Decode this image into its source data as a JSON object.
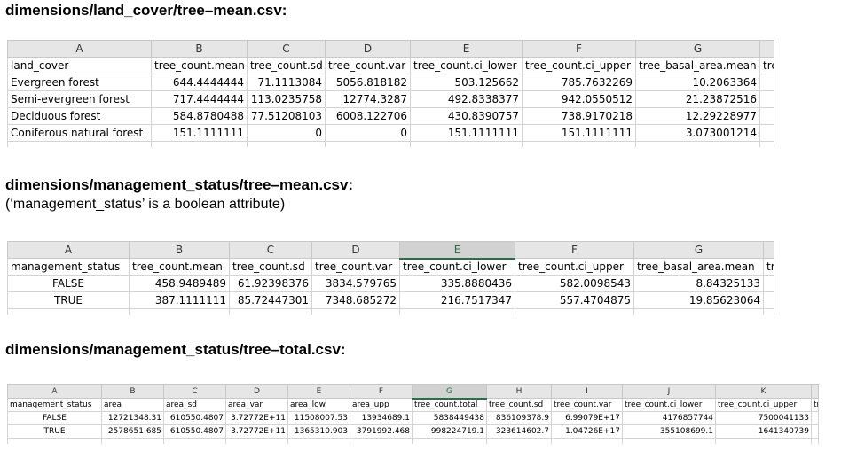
{
  "sections": [
    {
      "title": "dimensions/land_cover/tree–mean.csv:",
      "table": {
        "columns": [
          "A",
          "B",
          "C",
          "D",
          "E",
          "F",
          "G",
          ""
        ],
        "rows": [
          [
            "land_cover",
            "tree_count.mean",
            "tree_count.sd",
            "tree_count.var",
            "tree_count.ci_lower",
            "tree_count.ci_upper",
            "tree_basal_area.mean",
            "tre"
          ],
          [
            "Evergreen forest",
            "644.4444444",
            "71.1113084",
            "5056.818182",
            "503.125662",
            "785.7632269",
            "10.2063364",
            ""
          ],
          [
            "Semi-evergreen forest",
            "717.4444444",
            "113.0235758",
            "12774.3287",
            "492.8338377",
            "942.0550512",
            "21.23872516",
            ""
          ],
          [
            "Deciduous forest",
            "584.8780488",
            "77.51208103",
            "6008.122706",
            "430.8390757",
            "738.9170218",
            "12.29228977",
            ""
          ],
          [
            "Coniferous natural forest",
            "151.1111111",
            "0",
            "0",
            "151.1111111",
            "151.1111111",
            "3.073001214",
            ""
          ]
        ]
      }
    },
    {
      "title": "dimensions/management_status/tree–mean.csv:",
      "note": "(‘management_status’ is a boolean attribute)",
      "table": {
        "columns": [
          "A",
          "B",
          "C",
          "D",
          "E",
          "F",
          "G",
          ""
        ],
        "rows": [
          [
            "management_status",
            "tree_count.mean",
            "tree_count.sd",
            "tree_count.var",
            "tree_count.ci_lower",
            "tree_count.ci_upper",
            "tree_basal_area.mean",
            "tre"
          ],
          [
            "FALSE",
            "458.9489489",
            "61.92398376",
            "3834.579765",
            "335.8880436",
            "582.0098543",
            "8.84325133",
            ""
          ],
          [
            "TRUE",
            "387.1111111",
            "85.72447301",
            "7348.685272",
            "216.7517347",
            "557.4704875",
            "19.85623064",
            ""
          ]
        ]
      }
    },
    {
      "title": "dimensions/management_status/tree–total.csv:",
      "table": {
        "columns": [
          "A",
          "B",
          "C",
          "D",
          "E",
          "F",
          "G",
          "H",
          "I",
          "J",
          "K",
          ""
        ],
        "rows": [
          [
            "management_status",
            "area",
            "area_sd",
            "area_var",
            "area_low",
            "area_upp",
            "tree_count.total",
            "tree_count.sd",
            "tree_count.var",
            "tree_count.ci_lower",
            "tree_count.ci_upper",
            "tr"
          ],
          [
            "FALSE",
            "12721348.31",
            "610550.4807",
            "3.72772E+11",
            "11508007.53",
            "13934689.1",
            "5838449438",
            "836109378.9",
            "6.99079E+17",
            "4176857744",
            "7500041133",
            ""
          ],
          [
            "TRUE",
            "2578651.685",
            "610550.4807",
            "3.72772E+11",
            "1365310.903",
            "3791992.468",
            "998224719.1",
            "323614602.7",
            "1.04726E+17",
            "355108699.1",
            "1641340739",
            ""
          ]
        ]
      }
    }
  ]
}
